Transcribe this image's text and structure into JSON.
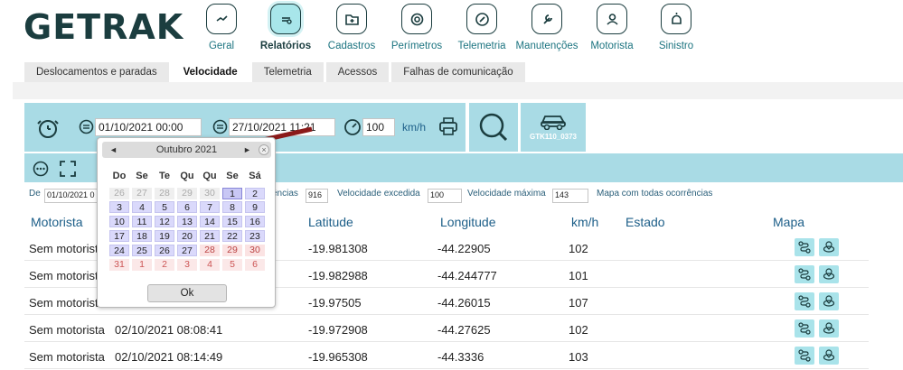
{
  "logo": "GETRAK",
  "nav": [
    {
      "label": "Geral",
      "icon": "dashboard-icon"
    },
    {
      "label": "Relatórios",
      "icon": "report-icon",
      "active": true
    },
    {
      "label": "Cadastros",
      "icon": "folder-add-icon"
    },
    {
      "label": "Perímetros",
      "icon": "perimeter-icon"
    },
    {
      "label": "Telemetria",
      "icon": "compass-icon"
    },
    {
      "label": "Manutenções",
      "icon": "wrench-icon"
    },
    {
      "label": "Motorista",
      "icon": "driver-icon"
    },
    {
      "label": "Sinistro",
      "icon": "alarm-icon"
    }
  ],
  "tabs": [
    "Deslocamentos e paradas",
    "Velocidade",
    "Telemetria",
    "Acessos",
    "Falhas de comunicação"
  ],
  "filters": {
    "date_from": "01/10/2021 00:00",
    "date_to": "27/10/2021 11:21",
    "speed": "100",
    "speed_unit": "km/h",
    "vehicle_label": "GTK110_0373"
  },
  "filter_row": {
    "de_label": "De",
    "de_value": "01/10/2021 0",
    "ocorrencias_label": "ências",
    "ocorrencias_value": "916",
    "vel_excedida_label": "Velocidade excedida",
    "vel_excedida_value": "100",
    "vel_max_label": "Velocidade máxima",
    "vel_max_value": "143",
    "mapa_label": "Mapa com todas ocorrências"
  },
  "table": {
    "headers": {
      "motorista": "Motorista",
      "latitude": "Latitude",
      "longitude": "Longitude",
      "kmh": "km/h",
      "estado": "Estado",
      "mapa": "Mapa"
    },
    "rows": [
      {
        "motorista": "Sem motorista",
        "datetime": "",
        "lat": "-19.981308",
        "lon": "-44.22905",
        "kmh": "102"
      },
      {
        "motorista": "Sem motorista",
        "datetime": "",
        "lat": "-19.982988",
        "lon": "-44.244777",
        "kmh": "101"
      },
      {
        "motorista": "Sem motorista",
        "datetime": "",
        "lat": "-19.97505",
        "lon": "-44.26015",
        "kmh": "107"
      },
      {
        "motorista": "Sem motorista",
        "datetime": "02/10/2021 08:08:41",
        "lat": "-19.972908",
        "lon": "-44.27625",
        "kmh": "102"
      },
      {
        "motorista": "Sem motorista",
        "datetime": "02/10/2021 08:14:49",
        "lat": "-19.965308",
        "lon": "-44.3336",
        "kmh": "103"
      }
    ]
  },
  "calendar": {
    "title": "Outubro 2021",
    "prev": "◄",
    "next": "►",
    "close": "×",
    "weekdays": [
      "Do",
      "Se",
      "Te",
      "Qu",
      "Qu",
      "Se",
      "Sá"
    ],
    "weeks": [
      [
        "26",
        "27",
        "28",
        "29",
        "30",
        "1",
        "2"
      ],
      [
        "3",
        "4",
        "5",
        "6",
        "7",
        "8",
        "9"
      ],
      [
        "10",
        "11",
        "12",
        "13",
        "14",
        "15",
        "16"
      ],
      [
        "17",
        "18",
        "19",
        "20",
        "21",
        "22",
        "23"
      ],
      [
        "24",
        "25",
        "26",
        "27",
        "28",
        "29",
        "30"
      ],
      [
        "31",
        "1",
        "2",
        "3",
        "4",
        "5",
        "6"
      ]
    ],
    "ok_label": "Ok"
  },
  "colors": {
    "accent": "#a9dbe5",
    "brand": "#1b3d3f",
    "arrow": "#8b1a1a"
  }
}
